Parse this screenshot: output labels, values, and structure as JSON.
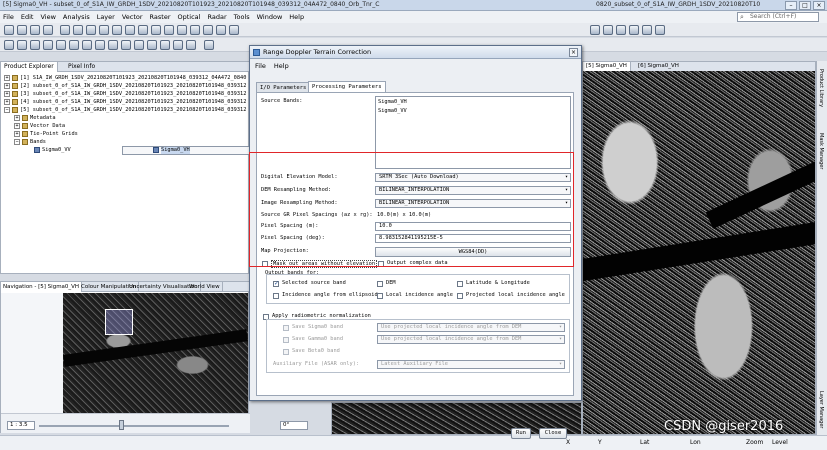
{
  "window": {
    "title": "[5] Sigma0_VH - subset_0_of_S1A_IW_GRDH_1SDV_20210820T101923_20210820T101948_039312_04A472_0840_Orb_Tnr_C",
    "title_right": "0820_subset_0_of_S1A_IW_GRDH_1SDV_20210820T10"
  },
  "menu": [
    "File",
    "Edit",
    "View",
    "Analysis",
    "Layer",
    "Vector",
    "Raster",
    "Optical",
    "Radar",
    "Tools",
    "Window",
    "Help"
  ],
  "search": {
    "placeholder": "Search (Ctrl+F)"
  },
  "product_explorer": {
    "tabs": [
      "Product Explorer",
      "Pixel Info"
    ],
    "items": [
      "[1] S1A_IW_GRDH_1SDV_20210820T101923_20210820T101948_039312_04A472_0840",
      "[2] subset_0_of_S1A_IW_GRDH_1SDV_20210820T101923_20210820T101948_039312",
      "[3] subset_0_of_S1A_IW_GRDH_1SDV_20210820T101923_20210820T101948_039312",
      "[4] subset_0_of_S1A_IW_GRDH_1SDV_20210820T101923_20210820T101948_039312",
      "[5] subset_0_of_S1A_IW_GRDH_1SDV_20210820T101923_20210820T101948_039312"
    ],
    "children": [
      "Metadata",
      "Vector Data",
      "Tie-Point Grids",
      "Bands"
    ],
    "bands": [
      "Sigma0_VH",
      "Sigma0_VV"
    ]
  },
  "navigation": {
    "tabs": [
      "Navigation - [5] Sigma0_VH",
      "Colour Manipulation",
      "Uncertainty Visualisation",
      "World View"
    ],
    "zoom": "1 : 3.5",
    "rotation": "0°"
  },
  "image_view": {
    "tabs": [
      "[5] Sigma0_VH",
      "[6] Sigma0_VH"
    ]
  },
  "right_strip": [
    "Product Library",
    "Mask Manager",
    "Layer Manager"
  ],
  "status": {
    "left": "X",
    "y": "Y",
    "lat": "Lat",
    "lon": "Lon",
    "zoom": "Zoom",
    "level": "Level"
  },
  "watermark": "CSDN @giser2016",
  "dialog": {
    "title": "Range Doppler Terrain Correction",
    "menu": [
      "File",
      "Help"
    ],
    "tabs": [
      "I/O Parameters",
      "Processing Parameters"
    ],
    "source_bands_label": "Source Bands:",
    "source_bands": [
      "Sigma0_VH",
      "Sigma0_VV"
    ],
    "dem_label": "Digital Elevation Model:",
    "dem_value": "SRTM 3Sec (Auto Download)",
    "dem_resampling_label": "DEM Resampling Method:",
    "dem_resampling_value": "BILINEAR_INTERPOLATION",
    "img_resampling_label": "Image Resampling Method:",
    "img_resampling_value": "BILINEAR_INTERPOLATION",
    "pixel_spacing_label": "Source GR Pixel Spacings (az x rg):",
    "pixel_spacing_value": "10.0(m) x 10.0(m)",
    "pixel_m_label": "Pixel Spacing (m):",
    "pixel_m_value": "10.0",
    "pixel_deg_label": "Pixel Spacing (deg):",
    "pixel_deg_value": "8.983152841195215E-5",
    "map_projection_label": "Map Projection:",
    "map_projection_value": "WGS84(DD)",
    "mask_label": "Mask out areas without elevation",
    "complex_label": "Output complex data",
    "output_bands_label": "Output bands for:",
    "out_selected": "Selected source band",
    "out_dem": "DEM",
    "out_latlon": "Latitude & Longitude",
    "out_inc_ellipsoid": "Incidence angle from ellipsoid",
    "out_local_inc": "Local incidence angle",
    "out_proj_local_inc": "Projected local incidence angle",
    "radiometric_label": "Apply radiometric normalization",
    "save_sigma0": "Save Sigma0 band",
    "save_sigma0_opt": "Use projected local incidence angle from DEM",
    "save_gamma0": "Save Gamma0 band",
    "save_gamma0_opt": "Use projected local incidence angle from DEM",
    "save_beta0": "Save Beta0 band",
    "aux_label": "Auxiliary File (ASAR only):",
    "aux_value": "Latest Auxiliary File",
    "run": "Run",
    "close": "Close"
  }
}
